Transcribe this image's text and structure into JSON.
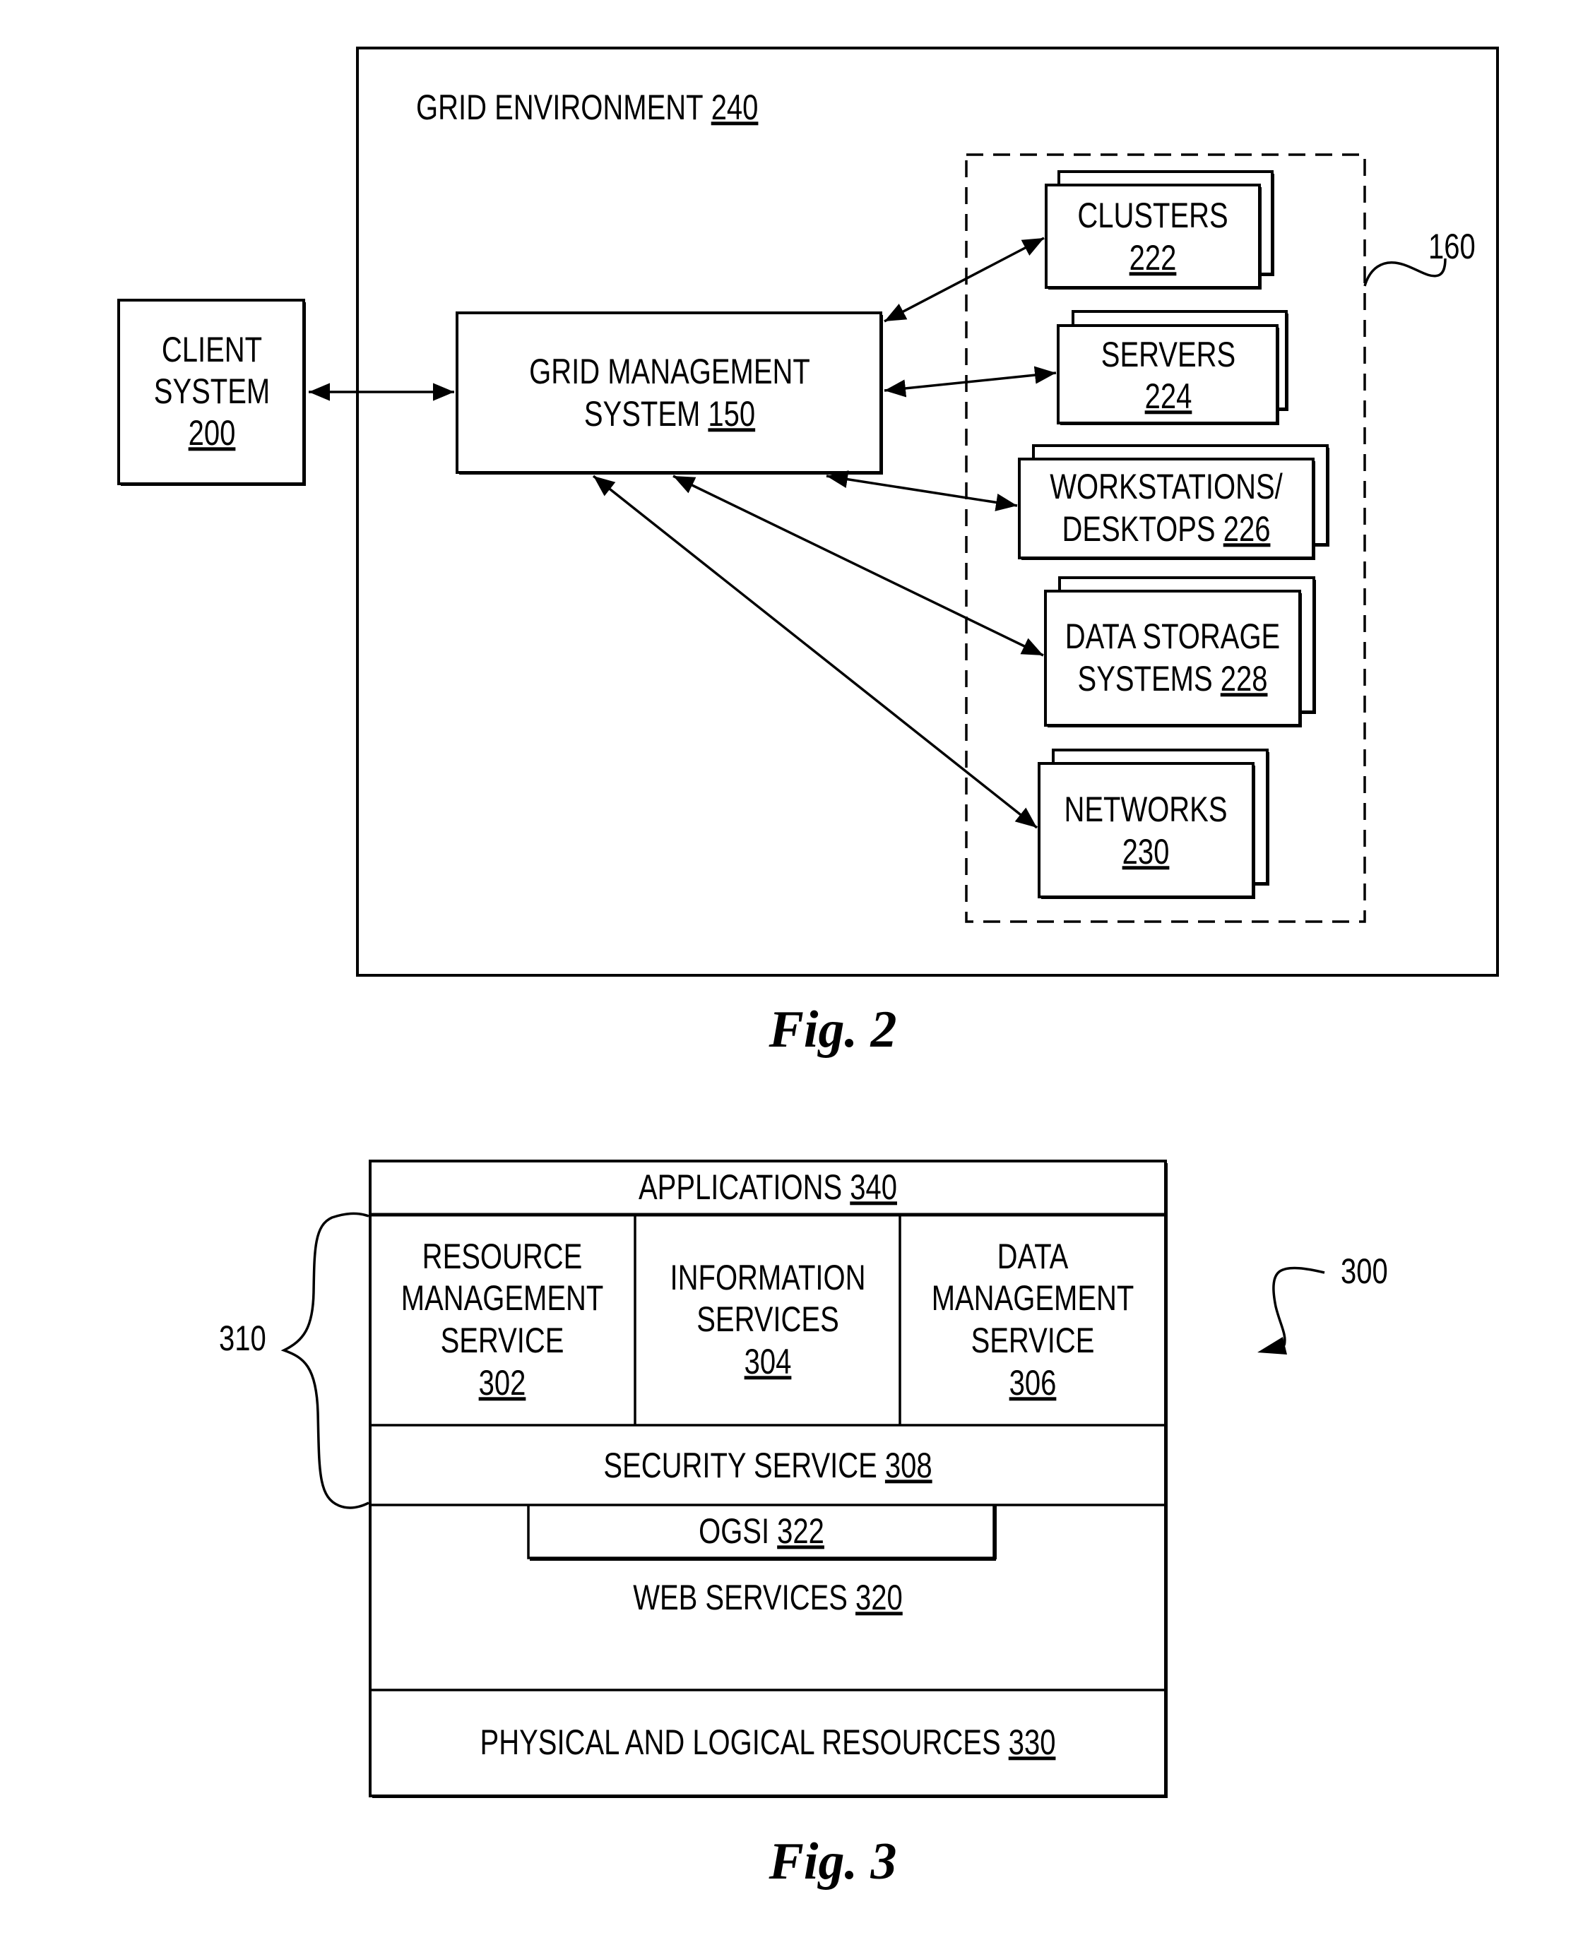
{
  "figure2": {
    "caption": "Fig. 2",
    "grid_environment": {
      "label": "GRID ENVIRONMENT",
      "ref": "240"
    },
    "client_system": {
      "lines": [
        "CLIENT",
        "SYSTEM"
      ],
      "ref": "200"
    },
    "grid_management_system": {
      "lines": [
        "GRID MANAGEMENT",
        "SYSTEM"
      ],
      "ref": "150"
    },
    "resource_group_ref": "160",
    "resources": [
      {
        "lines": [
          "CLUSTERS"
        ],
        "ref": "222"
      },
      {
        "lines": [
          "SERVERS"
        ],
        "ref": "224"
      },
      {
        "lines": [
          "WORKSTATIONS/",
          "DESKTOPS"
        ],
        "ref": "226"
      },
      {
        "lines": [
          "DATA STORAGE",
          "SYSTEMS"
        ],
        "ref": "228"
      },
      {
        "lines": [
          "NETWORKS"
        ],
        "ref": "230"
      }
    ]
  },
  "figure3": {
    "caption": "Fig. 3",
    "architecture_ref": "300",
    "services_group_ref": "310",
    "applications": {
      "label": "APPLICATIONS",
      "ref": "340"
    },
    "resource_management_service": {
      "lines": [
        "RESOURCE",
        "MANAGEMENT",
        "SERVICE"
      ],
      "ref": "302"
    },
    "information_services": {
      "lines": [
        "INFORMATION",
        "SERVICES"
      ],
      "ref": "304"
    },
    "data_management_service": {
      "lines": [
        "DATA",
        "MANAGEMENT",
        "SERVICE"
      ],
      "ref": "306"
    },
    "security_service": {
      "label": "SECURITY SERVICE",
      "ref": "308"
    },
    "ogsi": {
      "label": "OGSI",
      "ref": "322"
    },
    "web_services": {
      "label": "WEB SERVICES",
      "ref": "320"
    },
    "physical_logical_resources": {
      "label": "PHYSICAL AND LOGICAL RESOURCES",
      "ref": "330"
    }
  }
}
